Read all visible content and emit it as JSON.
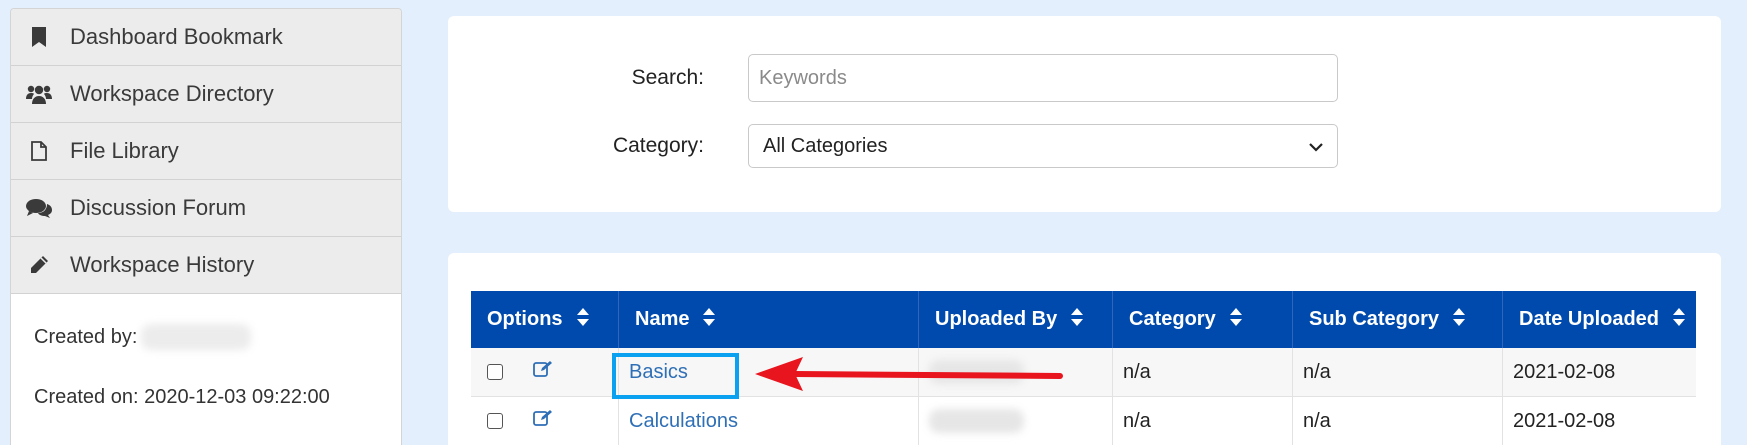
{
  "sidebar": {
    "items": [
      {
        "label": "Dashboard Bookmark",
        "icon": "bookmark-icon"
      },
      {
        "label": "Workspace Directory",
        "icon": "users-icon"
      },
      {
        "label": "File Library",
        "icon": "file-icon"
      },
      {
        "label": "Discussion Forum",
        "icon": "comments-icon"
      },
      {
        "label": "Workspace History",
        "icon": "pencil-icon"
      }
    ],
    "created_by_label": "Created by:",
    "created_on_label": "Created on:",
    "created_on_value": "2020-12-03 09:22:00"
  },
  "search": {
    "search_label": "Search:",
    "search_placeholder": "Keywords",
    "category_label": "Category:",
    "category_selected": "All Categories"
  },
  "table": {
    "headers": [
      "Options",
      "Name",
      "Uploaded By",
      "Category",
      "Sub Category",
      "Date Uploaded"
    ],
    "rows": [
      {
        "name": "Basics",
        "category": "n/a",
        "sub_category": "n/a",
        "date": "2021-02-08"
      },
      {
        "name": "Calculations",
        "category": "n/a",
        "sub_category": "n/a",
        "date": "2021-02-08"
      }
    ]
  },
  "colors": {
    "header_bg": "#004aad",
    "link": "#2f6fb6",
    "highlight_box": "#0aa2f0",
    "arrow": "#e8141e",
    "page_bg": "#e3effc"
  }
}
